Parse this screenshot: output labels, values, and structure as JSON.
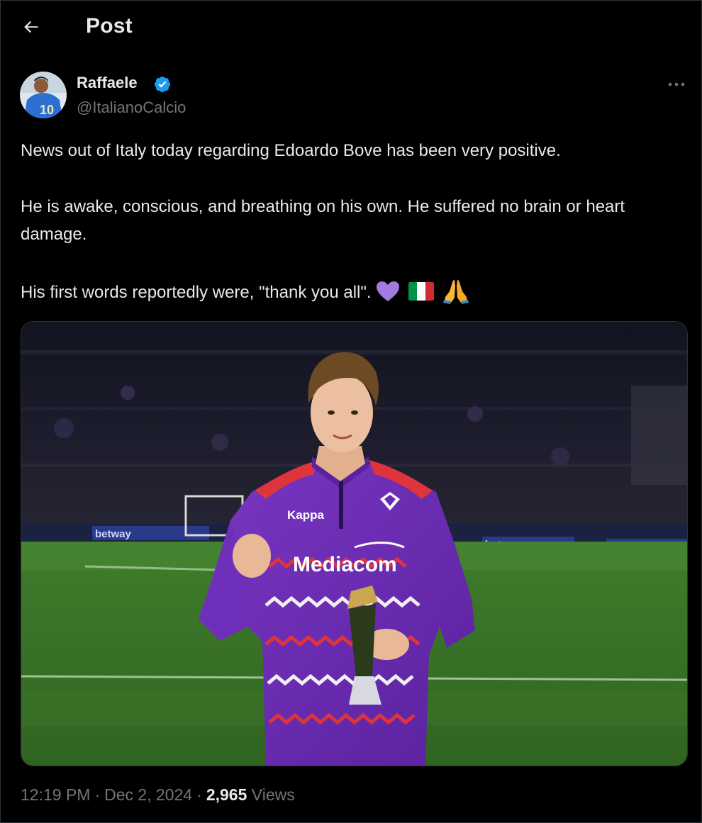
{
  "header": {
    "title": "Post",
    "back_icon": "arrow-left-icon"
  },
  "author": {
    "name": "Raffaele",
    "handle": "@ItalianoCalcio",
    "verified_color": "#1d9bf0",
    "avatar_icon": "avatar-blue-jersey-10"
  },
  "tweet": {
    "paragraph_1": "News out of Italy today regarding Edoardo Bove has been very positive.",
    "paragraph_2": "He is awake, conscious, and breathing on his own. He suffered no brain or heart damage.",
    "paragraph_3": "His first words reportedly were, \"thank you all\".",
    "emojis": [
      "purple-heart-icon",
      "italy-flag-icon",
      "folded-hands-icon"
    ]
  },
  "media": {
    "shirt_sponsor": "Mediacom",
    "shirt_brand": "Kappa",
    "board_text": "betway"
  },
  "meta": {
    "time": "12:19 PM",
    "separator": "·",
    "date": "Dec 2, 2024",
    "views_count": "2,965",
    "views_label": "Views"
  },
  "colors": {
    "background": "#000000",
    "text": "#e7e9ea",
    "muted": "#71767b",
    "accent": "#1d9bf0",
    "jersey_purple": "#6a2bb3"
  }
}
